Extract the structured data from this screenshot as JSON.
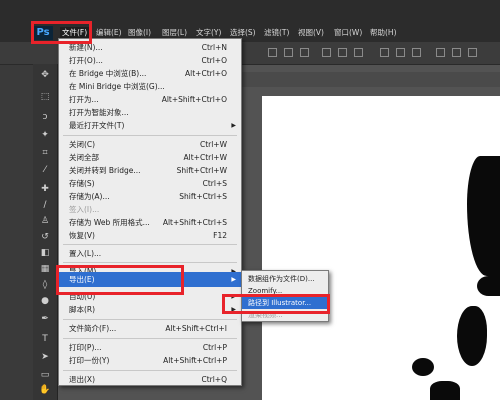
{
  "app": {
    "logo": "Ps"
  },
  "menubar": {
    "items": [
      "文件(F)",
      "编辑(E)",
      "图像(I)",
      "图层(L)",
      "文字(Y)",
      "选择(S)",
      "滤镜(T)",
      "视图(V)",
      "窗口(W)",
      "帮助(H)"
    ]
  },
  "file_menu": {
    "items": [
      {
        "label": "新建(N)...",
        "shortcut": "Ctrl+N"
      },
      {
        "label": "打开(O)...",
        "shortcut": "Ctrl+O"
      },
      {
        "label": "在 Bridge 中浏览(B)...",
        "shortcut": "Alt+Ctrl+O"
      },
      {
        "label": "在 Mini Bridge 中浏览(G)...",
        "shortcut": ""
      },
      {
        "label": "打开为...",
        "shortcut": "Alt+Shift+Ctrl+O"
      },
      {
        "label": "打开为智能对象...",
        "shortcut": ""
      },
      {
        "label": "最近打开文件(T)",
        "shortcut": ""
      },
      {
        "label": "关闭(C)",
        "shortcut": "Ctrl+W"
      },
      {
        "label": "关闭全部",
        "shortcut": "Alt+Ctrl+W"
      },
      {
        "label": "关闭并转到 Bridge...",
        "shortcut": "Shift+Ctrl+W"
      },
      {
        "label": "存储(S)",
        "shortcut": "Ctrl+S"
      },
      {
        "label": "存储为(A)...",
        "shortcut": "Shift+Ctrl+S"
      },
      {
        "label": "签入(I)...",
        "shortcut": ""
      },
      {
        "label": "存储为 Web 所用格式...",
        "shortcut": "Alt+Shift+Ctrl+S"
      },
      {
        "label": "恢复(V)",
        "shortcut": "F12"
      },
      {
        "label": "置入(L)...",
        "shortcut": ""
      },
      {
        "label": "导入(M)",
        "shortcut": ""
      },
      {
        "label": "导出(E)",
        "shortcut": ""
      },
      {
        "label": "自动(U)",
        "shortcut": ""
      },
      {
        "label": "脚本(R)",
        "shortcut": ""
      },
      {
        "label": "文件简介(F)...",
        "shortcut": "Alt+Shift+Ctrl+I"
      },
      {
        "label": "打印(P)...",
        "shortcut": "Ctrl+P"
      },
      {
        "label": "打印一份(Y)",
        "shortcut": "Alt+Shift+Ctrl+P"
      },
      {
        "label": "退出(X)",
        "shortcut": "Ctrl+Q"
      }
    ]
  },
  "export_submenu": {
    "items": [
      "数据组作为文件(D)...",
      "Zoomify...",
      "路径到 Illustrator...",
      "渲染视频..."
    ]
  },
  "colors": {
    "highlight_red": "#e8232a",
    "selection_blue": "#2f6fd0",
    "menu_bg": "#ededed"
  }
}
